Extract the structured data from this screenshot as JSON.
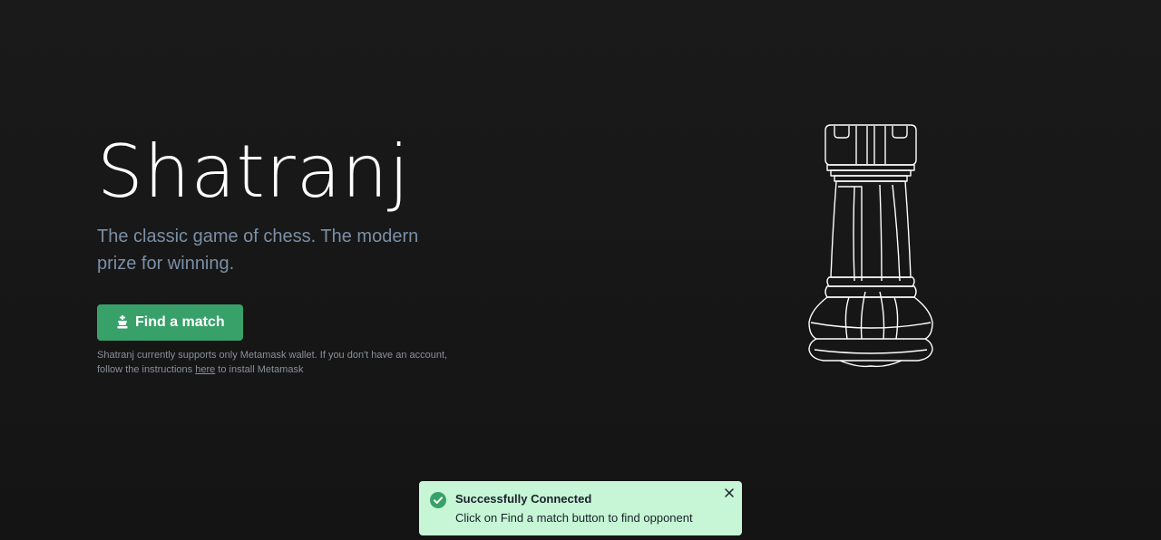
{
  "hero": {
    "title": "Shatranj",
    "tagline": "The classic game of chess. The modern prize for winning.",
    "cta_label": "Find a match",
    "note_before": "Shatranj currently supports only Metamask wallet. If you don't have an account, follow the instructions ",
    "note_link": "here",
    "note_after": " to install Metamask"
  },
  "illustration": {
    "icon": "chess-rook-icon"
  },
  "toast": {
    "title": "Successfully Connected",
    "description": "Click on Find a match button to find opponent",
    "status": "success"
  },
  "colors": {
    "background": "#161616",
    "accent": "#38a169",
    "toast_bg": "#c6f6d5",
    "tagline": "#7b8fa6"
  }
}
